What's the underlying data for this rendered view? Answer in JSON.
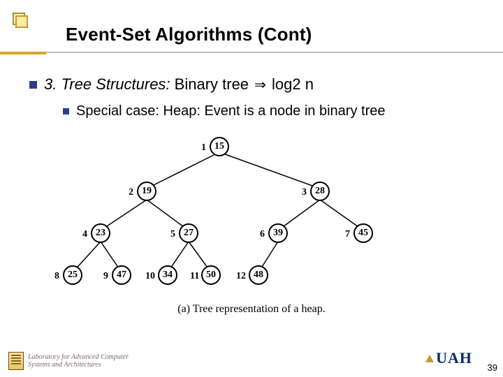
{
  "title": "Event-Set Algorithms (Cont)",
  "line1": {
    "prefix_italic": "3. Tree Structures:",
    "plain": "  Binary tree ",
    "arrow": "⇒",
    "post": " log2 n"
  },
  "line2": "Special case: Heap: Event is a node in binary tree",
  "nodes": {
    "n1": {
      "idx": "1",
      "val": "15"
    },
    "n2": {
      "idx": "2",
      "val": "19"
    },
    "n3": {
      "idx": "3",
      "val": "28"
    },
    "n4": {
      "idx": "4",
      "val": "23"
    },
    "n5": {
      "idx": "5",
      "val": "27"
    },
    "n6": {
      "idx": "6",
      "val": "39"
    },
    "n7": {
      "idx": "7",
      "val": "45"
    },
    "n8": {
      "idx": "8",
      "val": "25"
    },
    "n9": {
      "idx": "9",
      "val": "47"
    },
    "n10": {
      "idx": "10",
      "val": "34"
    },
    "n11": {
      "idx": "11",
      "val": "50"
    },
    "n12": {
      "idx": "12",
      "val": "48"
    }
  },
  "caption": "(a) Tree representation of a heap.",
  "lab_line1": "Laboratory for Advanced Computer",
  "lab_line2": "Systems and Architectures",
  "uah": "UAH",
  "pagenum": "39"
}
